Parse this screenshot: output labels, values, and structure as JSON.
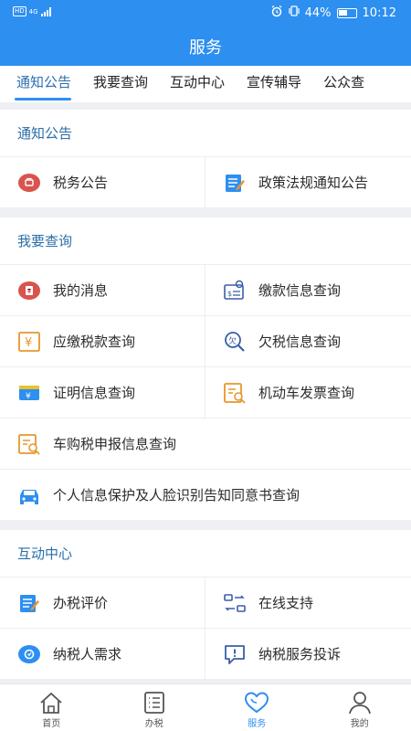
{
  "status_bar": {
    "network_badge": "HD",
    "network_type": "4G",
    "battery_percent": "44%",
    "time": "10:12"
  },
  "header": {
    "title": "服务"
  },
  "tabs": [
    {
      "label": "通知公告",
      "active": true
    },
    {
      "label": "我要查询",
      "active": false
    },
    {
      "label": "互动中心",
      "active": false
    },
    {
      "label": "宣传辅导",
      "active": false
    },
    {
      "label": "公众查",
      "active": false
    }
  ],
  "sections": {
    "notice": {
      "title": "通知公告",
      "items": [
        {
          "label": "税务公告",
          "icon": "tax-announcement-icon"
        },
        {
          "label": "政策法规通知公告",
          "icon": "policy-document-icon"
        }
      ]
    },
    "query": {
      "title": "我要查询",
      "items": [
        {
          "label": "我的消息",
          "icon": "message-icon"
        },
        {
          "label": "缴款信息查询",
          "icon": "payment-query-icon"
        },
        {
          "label": "应缴税款查询",
          "icon": "tax-due-icon"
        },
        {
          "label": "欠税信息查询",
          "icon": "arrears-icon"
        },
        {
          "label": "证明信息查询",
          "icon": "certificate-icon"
        },
        {
          "label": "机动车发票查询",
          "icon": "vehicle-invoice-icon"
        },
        {
          "label": "车购税申报信息查询",
          "icon": "purchase-tax-icon"
        },
        {
          "label": "个人信息保护及人脸识别告知同意书查询",
          "icon": "car-icon"
        }
      ]
    },
    "interaction": {
      "title": "互动中心",
      "items": [
        {
          "label": "办税评价",
          "icon": "evaluation-icon"
        },
        {
          "label": "在线支持",
          "icon": "online-support-icon"
        },
        {
          "label": "纳税人需求",
          "icon": "requirement-icon"
        },
        {
          "label": "纳税服务投诉",
          "icon": "complaint-icon"
        }
      ]
    }
  },
  "bottom_nav": [
    {
      "label": "首页",
      "icon": "home-icon",
      "active": false
    },
    {
      "label": "办税",
      "icon": "tax-list-icon",
      "active": false
    },
    {
      "label": "服务",
      "icon": "heart-icon",
      "active": true
    },
    {
      "label": "我的",
      "icon": "person-icon",
      "active": false
    }
  ],
  "colors": {
    "primary": "#2d8ff0",
    "section_title": "#2a6ea9",
    "icon_orange": "#e8962b",
    "icon_red": "#d9534f",
    "icon_blue": "#2d8ff0"
  }
}
